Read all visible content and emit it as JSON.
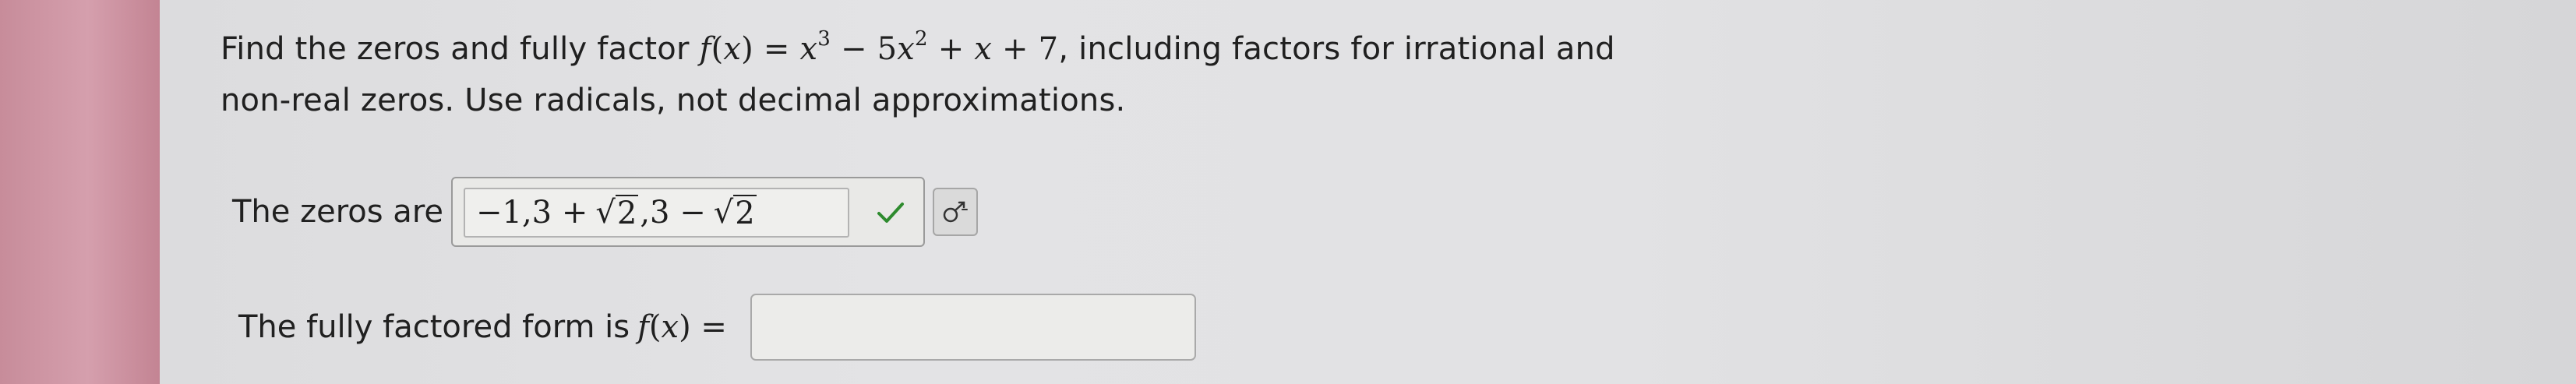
{
  "question": {
    "line1_prefix": "Find the zeros and fully factor",
    "function_name": "f",
    "function_var": "x",
    "poly_term1_base": "x",
    "poly_term1_exp": "3",
    "poly_op1": "−",
    "poly_term2_coef": "5",
    "poly_term2_base": "x",
    "poly_term2_exp": "2",
    "poly_op2": "+",
    "poly_term3": "x",
    "poly_op3": "+",
    "poly_term4": "7",
    "line1_suffix": ", including factors for irrational and",
    "line2": "non-real zeros. Use radicals, not decimal approximations."
  },
  "zeros": {
    "label": "The zeros are",
    "value_part1": "−1,3 +",
    "radical1": "2",
    "value_part2": ",3 −",
    "radical2": "2"
  },
  "factored": {
    "label": "The fully factored form is",
    "lhs_name": "f",
    "lhs_var": "x",
    "equals": "=",
    "value": ""
  },
  "icons": {
    "check": "check-icon",
    "format": "math-format-icon"
  },
  "colors": {
    "check_green": "#2e8b2e",
    "left_strip": "#c98e9c"
  }
}
